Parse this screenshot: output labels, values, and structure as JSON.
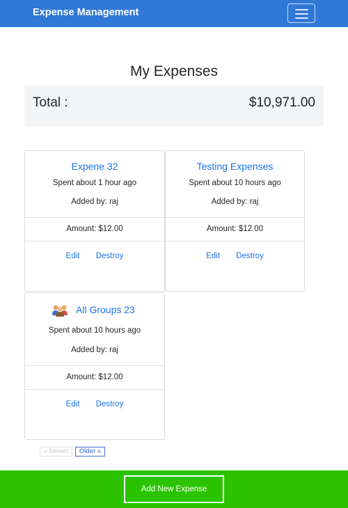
{
  "navbar": {
    "brand": "Expense Management",
    "menu_icon": "hamburger-icon",
    "color": "#2f78d6"
  },
  "page": {
    "title": "My Expenses"
  },
  "summary": {
    "label": "Total :",
    "value": "$10,971.00"
  },
  "expenses": [
    {
      "title": "Expene 32",
      "spent": "Spent about 1 hour ago",
      "added": "Added by: raj",
      "amount": "Amount: $12.00",
      "edit": "Edit",
      "destroy": "Destroy"
    },
    {
      "title": "Testing Expenses",
      "spent": "Spent about 10 hours ago",
      "added": "Added by: raj",
      "amount": "Amount: $12.00",
      "edit": "Edit",
      "destroy": "Destroy"
    },
    {
      "title": "All Groups 23",
      "icon": "group-people-icon",
      "spent": "Spent about 10 hours ago",
      "added": "Added by: raj",
      "amount": "Amount: $12.00",
      "edit": "Edit",
      "destroy": "Destroy"
    }
  ],
  "pagination": {
    "newer": "« Newer",
    "older": "Older »"
  },
  "footer": {
    "add_button": "Add New Expense",
    "color": "#2bc300"
  }
}
